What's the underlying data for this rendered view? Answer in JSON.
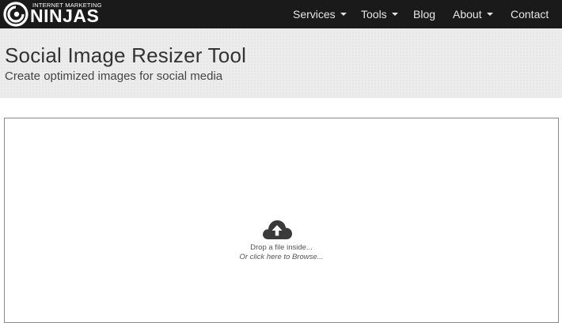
{
  "logo": {
    "top_text": "INTERNET MARKETING",
    "main_text": "NINJAS"
  },
  "nav": {
    "items": [
      {
        "label": "Services",
        "dropdown": true
      },
      {
        "label": "Tools",
        "dropdown": true
      },
      {
        "label": "Blog",
        "dropdown": false
      },
      {
        "label": "About",
        "dropdown": true
      },
      {
        "label": "Contact",
        "dropdown": false
      }
    ]
  },
  "hero": {
    "title": "Social Image Resizer Tool",
    "subtitle": "Create optimized images for social media"
  },
  "dropzone": {
    "icon": "cloud-upload-icon",
    "line1": "Drop a file inside...",
    "line2": "Or click here to Browse..."
  },
  "colors": {
    "navbar": "#1a1a1a",
    "hero_bg": "#ececec",
    "text_dark": "#333333"
  }
}
